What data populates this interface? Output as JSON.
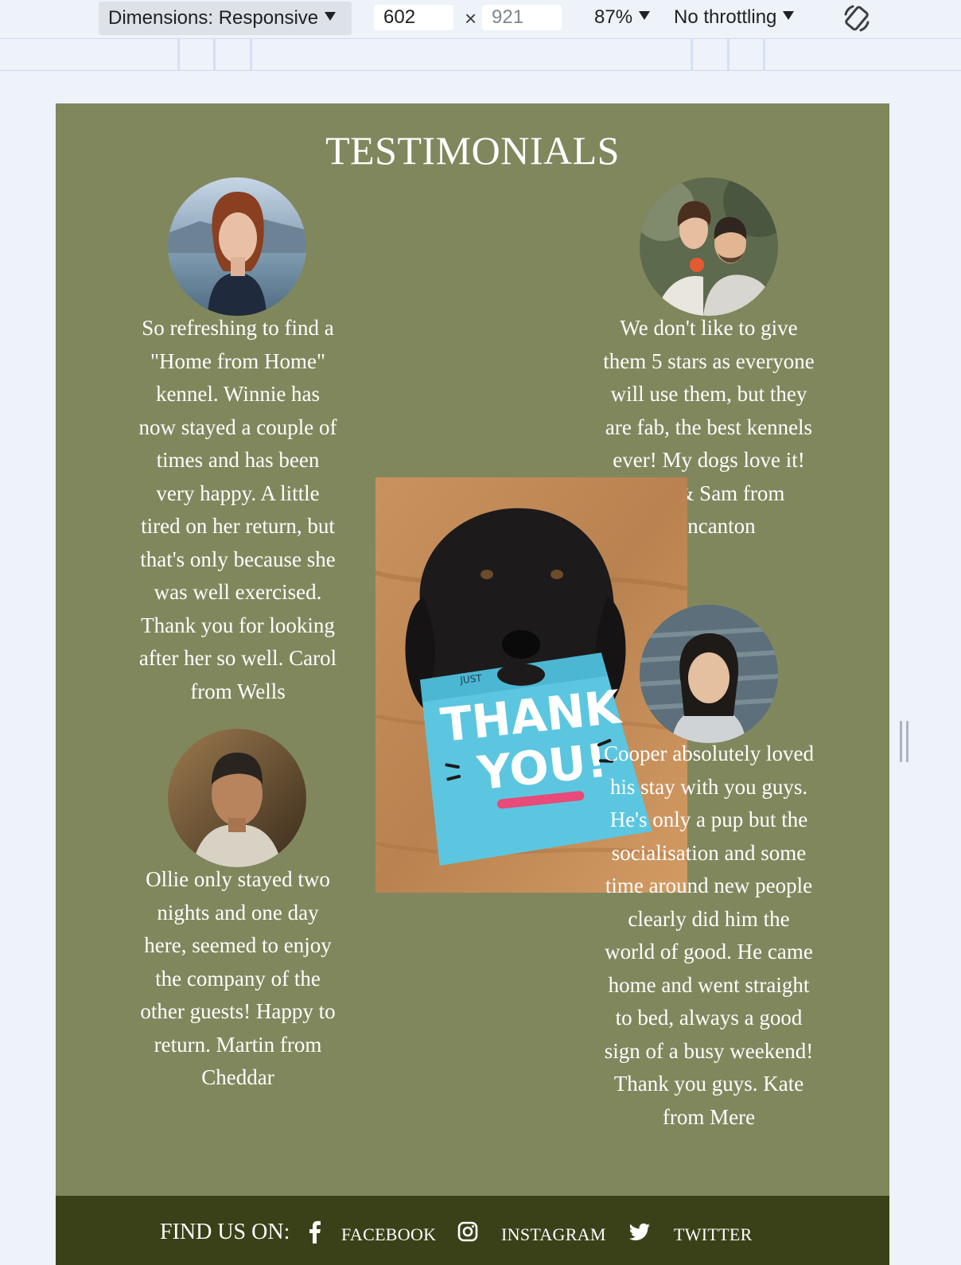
{
  "devtools": {
    "dimensions_label": "Dimensions: Responsive",
    "width_value": "602",
    "height_placeholder": "921",
    "times_symbol": "×",
    "zoom": "87%",
    "throttling": "No throttling"
  },
  "page": {
    "title": "TESTIMONIALS",
    "testimonials": [
      {
        "photo": "woman-red-hair-portrait",
        "text": "So refreshing to find a \"Home from Home\" kennel. Winnie has now stayed a couple of times and has been very happy. A little tired on her return, but that's only because she was well exercised. Thank you for looking after her so well. Carol from Wells"
      },
      {
        "photo": "couple-portrait",
        "text": "We don't like to give them 5 stars as everyone will use them, but they are fab, the best kennels ever! My dogs love it! Tom & Sam from Wincanton"
      },
      {
        "photo": "older-man-portrait",
        "text": "Ollie only stayed two nights and one day here, seemed to enjoy the company of the other guests! Happy to return. Martin from Cheddar"
      },
      {
        "photo": "young-woman-portrait",
        "text": "Cooper absolutely loved his stay with you guys. He's only a pup but the socialisation and some time around new people clearly did him the world of good. He came home and went straight to bed, always a good sign of a busy weekend! Thank you guys. Kate from Mere"
      }
    ],
    "center_image": {
      "card_small_text": "JUST",
      "card_line1": "THANK",
      "card_line2": "YOU!"
    },
    "footer": {
      "find_us": "FIND US ON:",
      "links": [
        {
          "icon": "facebook-icon",
          "label": "FACEBOOK"
        },
        {
          "icon": "instagram-icon",
          "label": "INSTAGRAM"
        },
        {
          "icon": "twitter-icon",
          "label": "TWITTER"
        }
      ]
    }
  }
}
